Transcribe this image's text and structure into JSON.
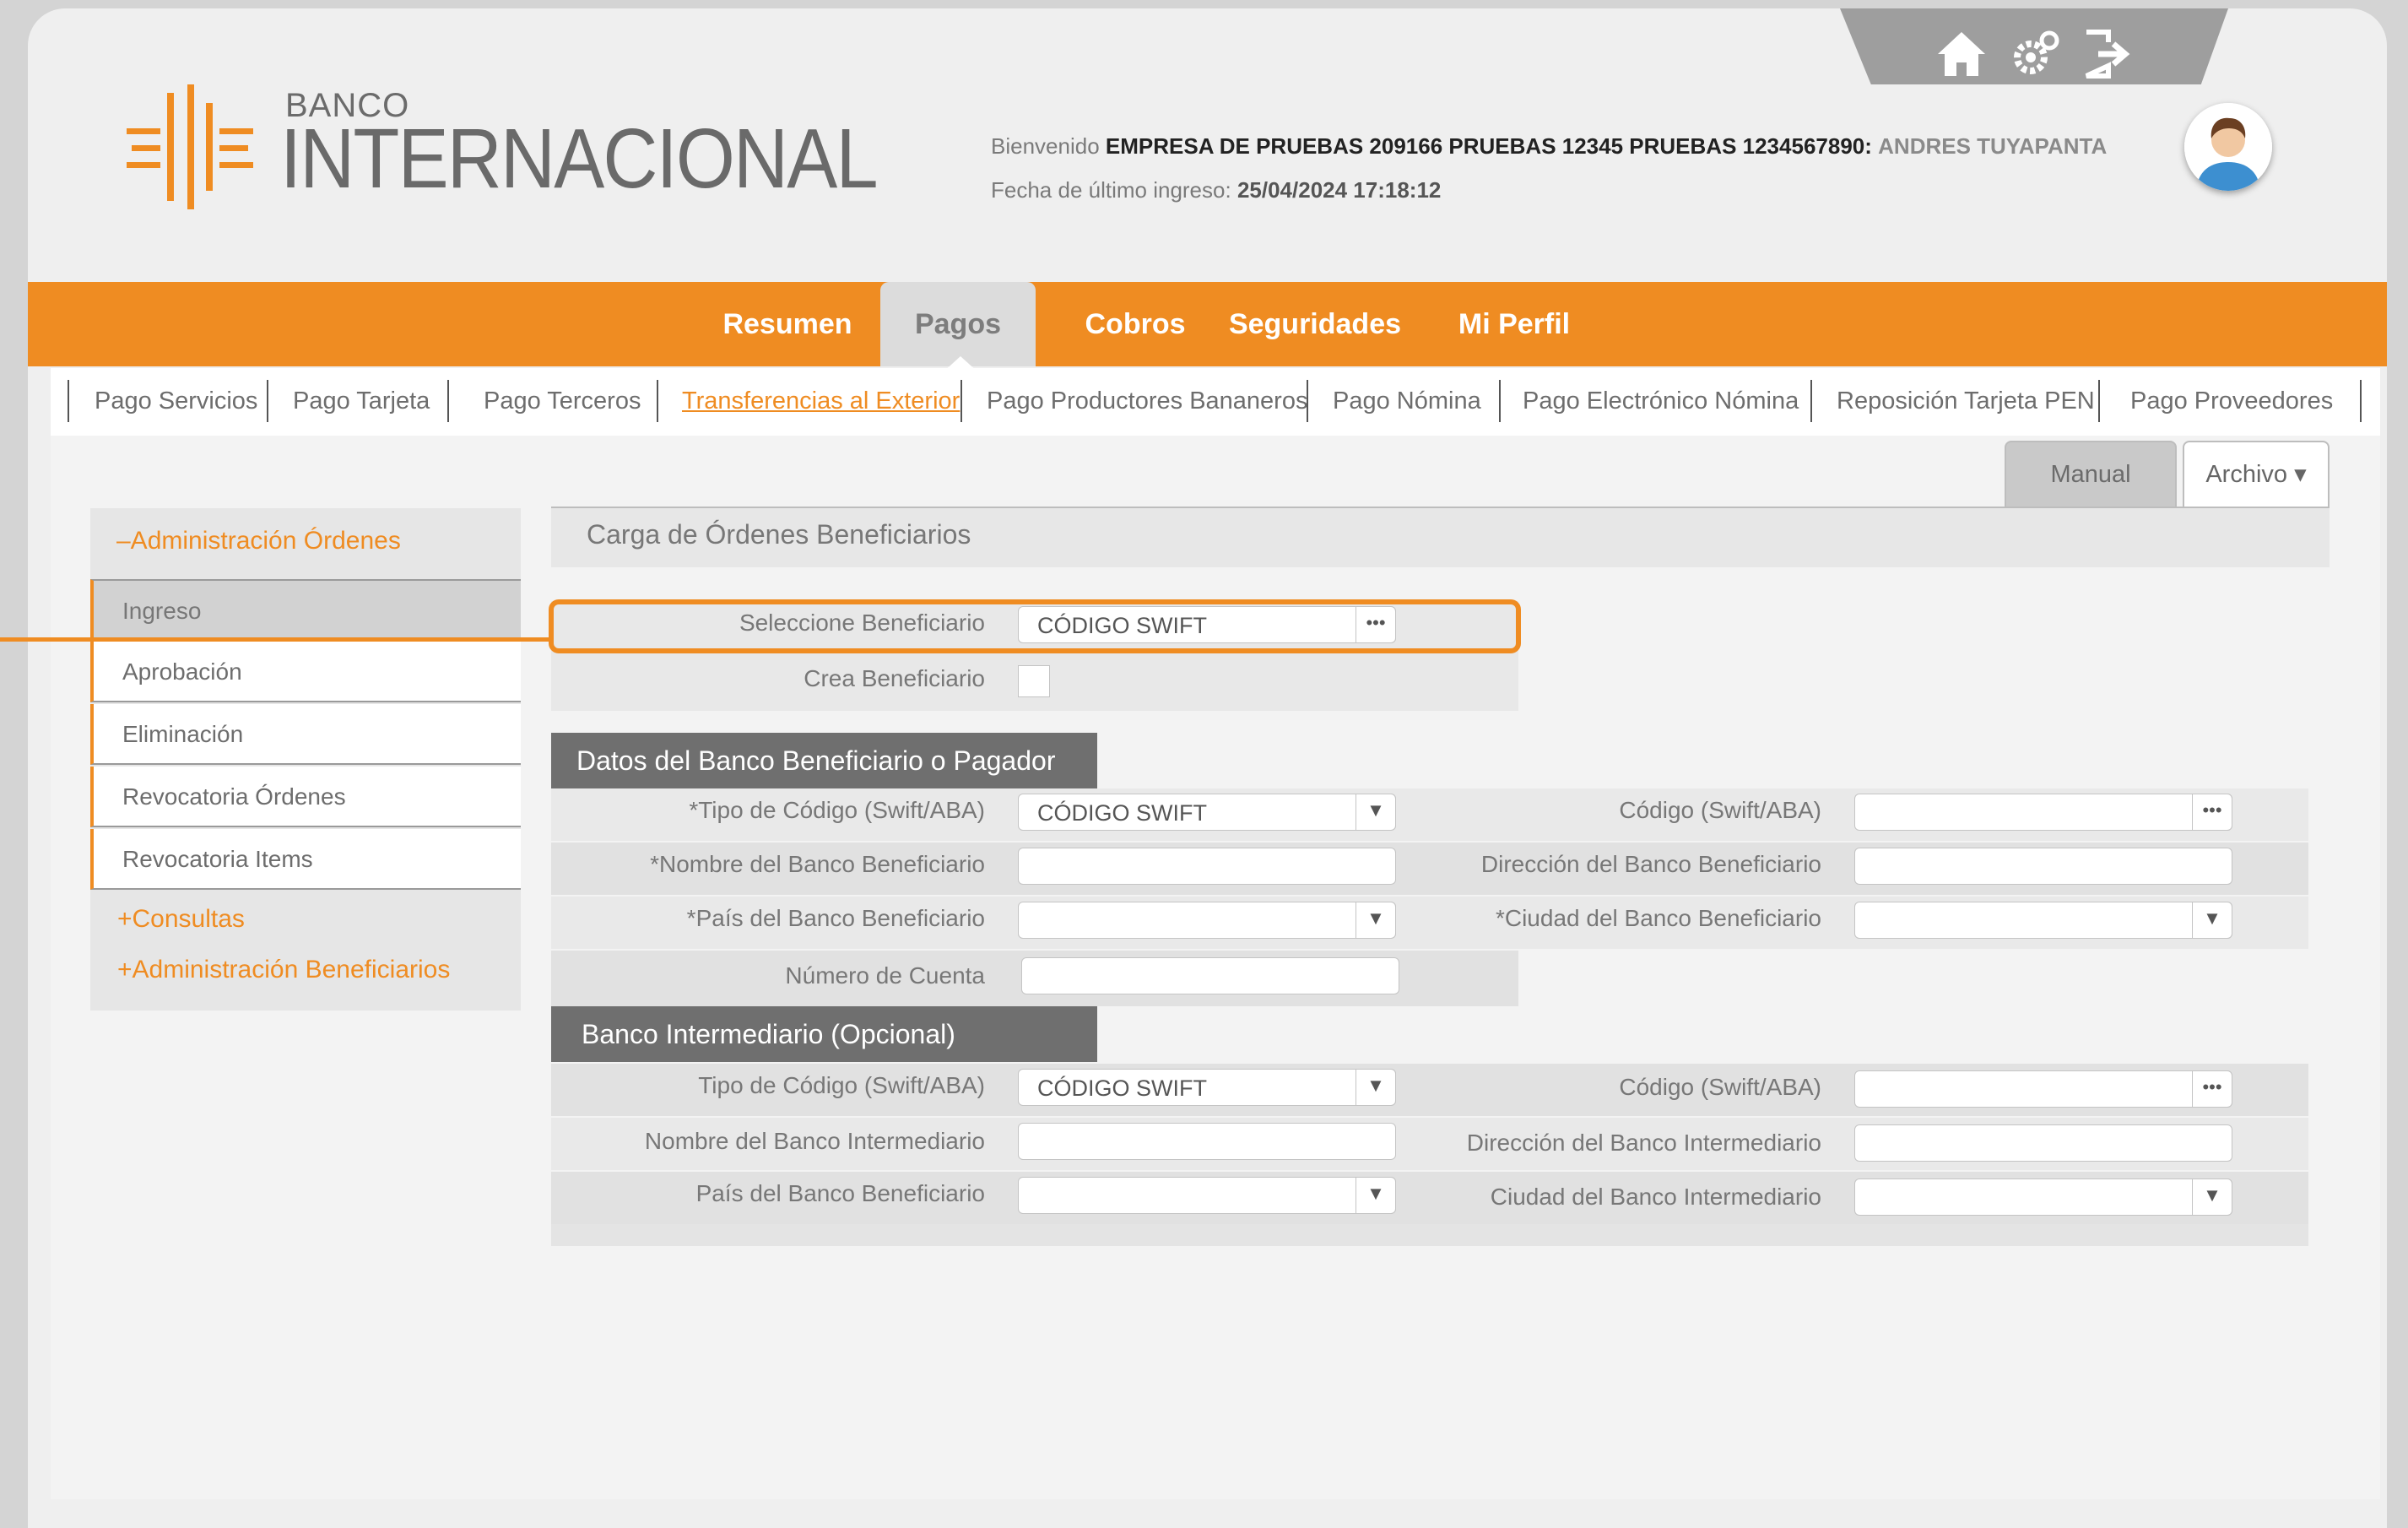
{
  "brand": {
    "small": "BANCO",
    "large": "INTERNACIONAL",
    "accent": "#ef8c22"
  },
  "toolbar": {
    "icons": [
      "home-icon",
      "settings-icon",
      "logout-icon"
    ]
  },
  "header": {
    "welcome_prefix": "Bienvenido",
    "company": "EMPRESA DE PRUEBAS 209166 PRUEBAS 12345 PRUEBAS 1234567890:",
    "user": "ANDRES TUYAPANTA",
    "last_login_label": "Fecha de último ingreso:",
    "last_login_value": "25/04/2024 17:18:12"
  },
  "nav": {
    "items": [
      "Resumen",
      "Pagos",
      "Cobros",
      "Seguridades",
      "Mi Perfil"
    ],
    "active": "Pagos"
  },
  "subnav": {
    "items": [
      "Pago Servicios",
      "Pago Tarjeta",
      "Pago Terceros",
      "Transferencias al Exterior",
      "Pago Productores Bananeros",
      "Pago Nómina",
      "Pago Electrónico Nómina",
      "Reposición Tarjeta PEN",
      "Pago Proveedores"
    ],
    "active": "Transferencias al Exterior"
  },
  "mode": {
    "manual": "Manual",
    "archivo": "Archivo ▾"
  },
  "sidebar": {
    "admin_ordenes": "–Administración Órdenes",
    "items": [
      "Ingreso",
      "Aprobación",
      "Eliminación",
      "Revocatoria Órdenes",
      "Revocatoria Items"
    ],
    "selected": "Ingreso",
    "consultas": "+Consultas",
    "admin_beneficiarios": "+Administración Beneficiarios"
  },
  "form": {
    "title": "Carga de Órdenes Beneficiarios",
    "select_beneficiary_label": "Seleccione Beneficiario",
    "select_beneficiary_value": "CÓDIGO SWIFT",
    "create_beneficiary_label": "Crea Beneficiario",
    "bank_section": {
      "title": "Datos del Banco Beneficiario o Pagador",
      "code_type_label": "*Tipo de Código (Swift/ABA)",
      "code_type_value": "CÓDIGO SWIFT",
      "code_label": "Código (Swift/ABA)",
      "bank_name_label": "*Nombre del Banco Beneficiario",
      "bank_address_label": "Dirección del Banco Beneficiario",
      "country_label": "*País del Banco Beneficiario",
      "city_label": "*Ciudad del Banco Beneficiario",
      "account_label": "Número de Cuenta"
    },
    "intermediary_section": {
      "title": "Banco Intermediario (Opcional)",
      "code_type_label": "Tipo de Código (Swift/ABA)",
      "code_type_value": "CÓDIGO SWIFT",
      "code_label": "Código (Swift/ABA)",
      "bank_name_label": "Nombre del Banco Intermediario",
      "bank_address_label": "Dirección del Banco Intermediario",
      "country_label": "País del Banco Beneficiario",
      "city_label": "Ciudad del Banco Intermediario"
    }
  }
}
